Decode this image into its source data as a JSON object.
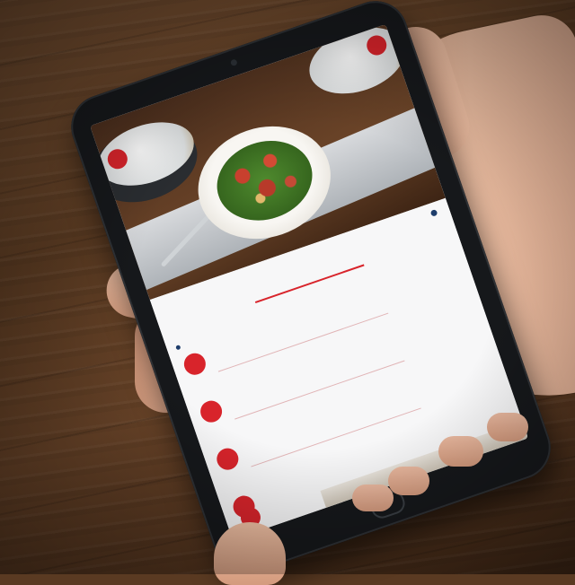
{
  "scene": {
    "description_icons": [
      "tablet",
      "hand",
      "food-photo",
      "wood-table"
    ]
  },
  "menu": {
    "title": "",
    "items": [
      {
        "badge": "",
        "name": "",
        "desc": "",
        "price": ""
      },
      {
        "badge": "",
        "name": "",
        "desc": "",
        "price": ""
      },
      {
        "badge": "",
        "name": "",
        "desc": "",
        "price": ""
      },
      {
        "badge": "",
        "name": "",
        "desc": "",
        "price": ""
      }
    ]
  },
  "colors": {
    "accent": "#d8242b",
    "text": "#1e3d6b",
    "bezel": "#16181b",
    "wood": "#5b3b22"
  }
}
